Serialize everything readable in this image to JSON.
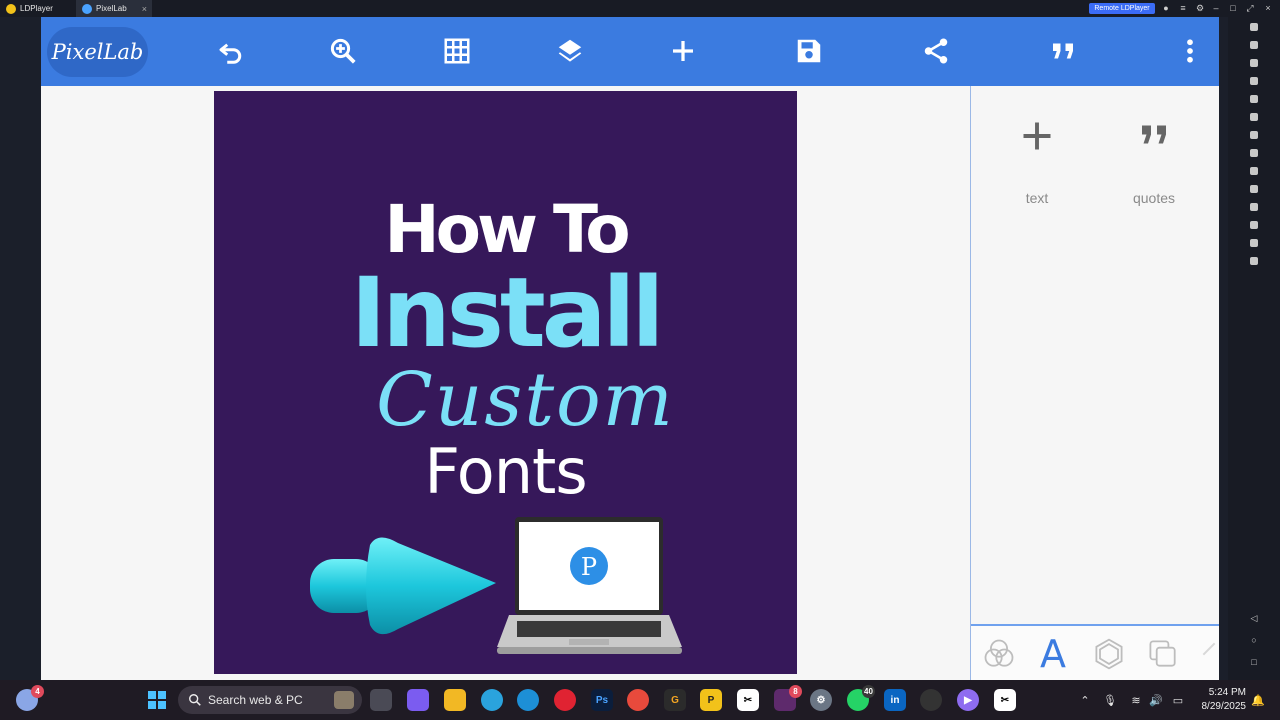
{
  "window": {
    "tabs": [
      {
        "label": "LDPlayer"
      },
      {
        "label": "PixelLab"
      }
    ],
    "remote_button": "Remote LDPlayer"
  },
  "app": {
    "logo_text": "PixelLab",
    "toolbar_icons": [
      "undo-icon",
      "zoom-in-icon",
      "grid-icon",
      "layers-icon",
      "add-icon",
      "save-icon",
      "share-icon",
      "quote-icon",
      "more-vert-icon"
    ],
    "accent_color": "#3b7be0"
  },
  "canvas": {
    "background_color": "#36185a",
    "line1": "How To",
    "line2": "Install",
    "line3": "Custom",
    "line4": "Fonts",
    "laptop_logo": "P"
  },
  "right_panel": {
    "items": [
      {
        "label": "text",
        "icon": "plus-icon"
      },
      {
        "label": "quotes",
        "icon": "quote-icon"
      }
    ],
    "bottom_tabs": [
      "blend-icon",
      "text-tab-icon",
      "shape-icon",
      "layer-copy-icon"
    ],
    "text_tab_glyph": "A"
  },
  "taskbar": {
    "weather_badge": "4",
    "search_placeholder": "Search web & PC",
    "slack_badge": "8",
    "whatsapp_badge": "40",
    "time": "5:24 PM",
    "date": "8/29/2025"
  }
}
